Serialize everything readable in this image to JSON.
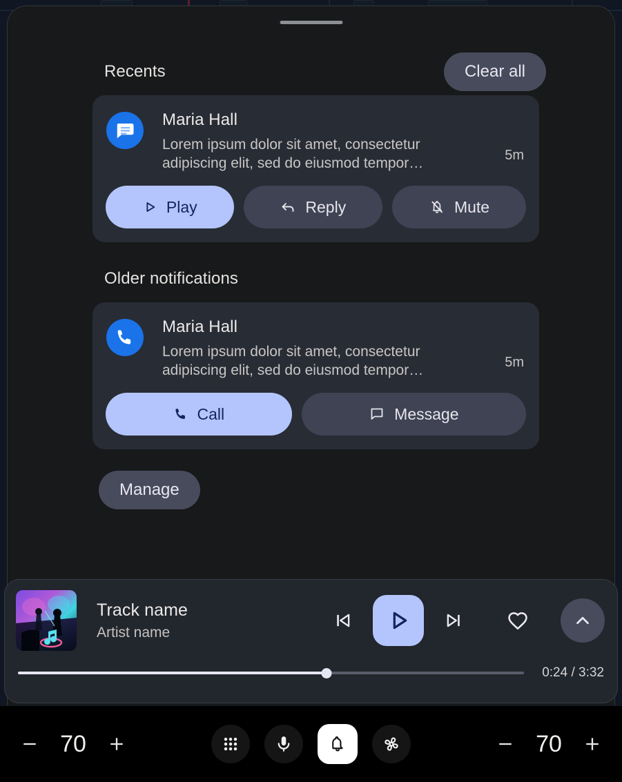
{
  "sheet": {
    "drag_handle": "drag-handle",
    "recents": {
      "title": "Recents",
      "clear_all_label": "Clear all"
    },
    "older": {
      "title": "Older notifications"
    },
    "manage_label": "Manage"
  },
  "notifications": [
    {
      "group": "recents",
      "app_icon": "message-icon",
      "title": "Maria Hall",
      "body": "Lorem ipsum dolor sit amet, consectetur adipiscing elit, sed do eiusmod tempor…",
      "time": "5m",
      "actions": [
        {
          "label": "Play",
          "icon": "play-icon",
          "style": "primary"
        },
        {
          "label": "Reply",
          "icon": "reply-icon",
          "style": "secondary"
        },
        {
          "label": "Mute",
          "icon": "mute-icon",
          "style": "secondary"
        }
      ]
    },
    {
      "group": "older",
      "app_icon": "phone-icon",
      "title": "Maria Hall",
      "body": "Lorem ipsum dolor sit amet, consectetur adipiscing elit, sed do eiusmod tempor…",
      "time": "5m",
      "actions": [
        {
          "label": "Call",
          "icon": "call-icon",
          "style": "primary"
        },
        {
          "label": "Message",
          "icon": "message-bubble-icon",
          "style": "secondary"
        }
      ]
    }
  ],
  "media": {
    "album_art": "concert-album-art",
    "track_name": "Track name",
    "artist_name": "Artist name",
    "controls": {
      "previous": "skip-previous-icon",
      "play": "play-icon",
      "next": "skip-next-icon",
      "like": "heart-icon",
      "expand": "chevron-up-icon"
    },
    "progress": {
      "elapsed": "0:24",
      "duration": "3:32",
      "time_label": "0:24 / 3:32",
      "percent": 61
    }
  },
  "bottom_bar": {
    "left_volume": {
      "minus": "−",
      "value": "70",
      "plus": "+"
    },
    "right_volume": {
      "minus": "−",
      "value": "70",
      "plus": "+"
    },
    "nav_items": [
      {
        "icon": "apps-grid-icon",
        "active": false
      },
      {
        "icon": "microphone-icon",
        "active": false
      },
      {
        "icon": "bell-icon",
        "active": true
      },
      {
        "icon": "fan-icon",
        "active": false
      }
    ]
  },
  "colors": {
    "accent": "#b3c5fc",
    "accent_text": "#12265c",
    "sheet_bg": "#17191a",
    "card_bg": "#282c35",
    "secondary_btn": "#3f4354",
    "app_blue": "#1a73e8",
    "bottom_bar_bg": "#000000"
  }
}
